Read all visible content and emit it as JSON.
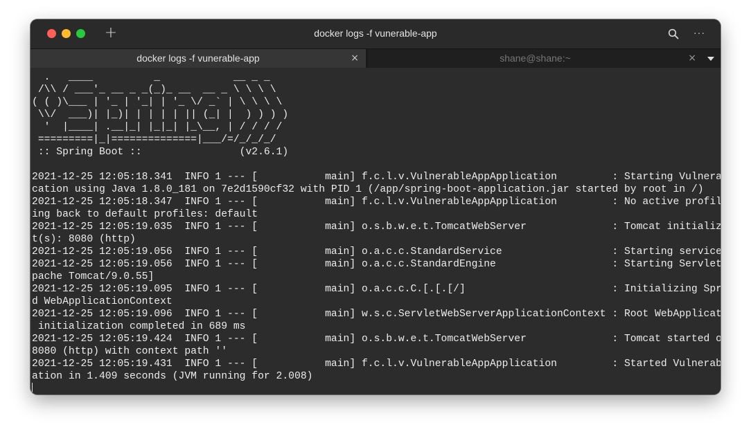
{
  "window": {
    "title": "docker logs -f vunerable-app",
    "new_tab_glyph": "+",
    "more_glyph": "···",
    "search_icon": "search-icon",
    "colors": {
      "close": "#ff5f57",
      "minimize": "#febc2e",
      "zoom": "#28c840"
    }
  },
  "tabs": [
    {
      "label": "docker logs -f vunerable-app",
      "close_glyph": "×",
      "active": true
    },
    {
      "label": "shane@shane:~",
      "close_glyph": "×",
      "active": false
    }
  ],
  "terminal": {
    "lines": [
      "  .   ____          _            __ _ _",
      " /\\\\ / ___'_ __ _ _(_)_ __  __ _ \\ \\ \\ \\",
      "( ( )\\___ | '_ | '_| | '_ \\/ _` | \\ \\ \\ \\",
      " \\\\/  ___)| |_)| | | | | || (_| |  ) ) ) )",
      "  '  |____| .__|_| |_|_| |_\\__, | / / / /",
      " =========|_|==============|___/=/_/_/_/",
      " :: Spring Boot ::                (v2.6.1)",
      "",
      "2021-12-25 12:05:18.341  INFO 1 --- [           main] f.c.l.v.VulnerableAppApplication         : Starting VulnerableAppAppli",
      "cation using Java 1.8.0_181 on 7e2d1590cf32 with PID 1 (/app/spring-boot-application.jar started by root in /)",
      "2021-12-25 12:05:18.347  INFO 1 --- [           main] f.c.l.v.VulnerableAppApplication         : No active profile set, fall",
      "ing back to default profiles: default",
      "2021-12-25 12:05:19.035  INFO 1 --- [           main] o.s.b.w.e.t.TomcatWebServer              : Tomcat initialized with por",
      "t(s): 8080 (http)",
      "2021-12-25 12:05:19.056  INFO 1 --- [           main] o.a.c.c.StandardService                  : Starting service [Tomcat]",
      "2021-12-25 12:05:19.056  INFO 1 --- [           main] o.a.c.c.StandardEngine                   : Starting Servlet engine: [A",
      "pache Tomcat/9.0.55]",
      "2021-12-25 12:05:19.095  INFO 1 --- [           main] o.a.c.c.C.[.[.[/]                        : Initializing Spring embedde",
      "d WebApplicationContext",
      "2021-12-25 12:05:19.096  INFO 1 --- [           main] w.s.c.ServletWebServerApplicationContext : Root WebApplicationContext:",
      " initialization completed in 689 ms",
      "2021-12-25 12:05:19.424  INFO 1 --- [           main] o.s.b.w.e.t.TomcatWebServer              : Tomcat started on port(s):",
      "8080 (http) with context path ''",
      "2021-12-25 12:05:19.431  INFO 1 --- [           main] f.c.l.v.VulnerableAppApplication         : Started VulnerableAppApplic",
      "ation in 1.409 seconds (JVM running for 2.008)"
    ]
  }
}
